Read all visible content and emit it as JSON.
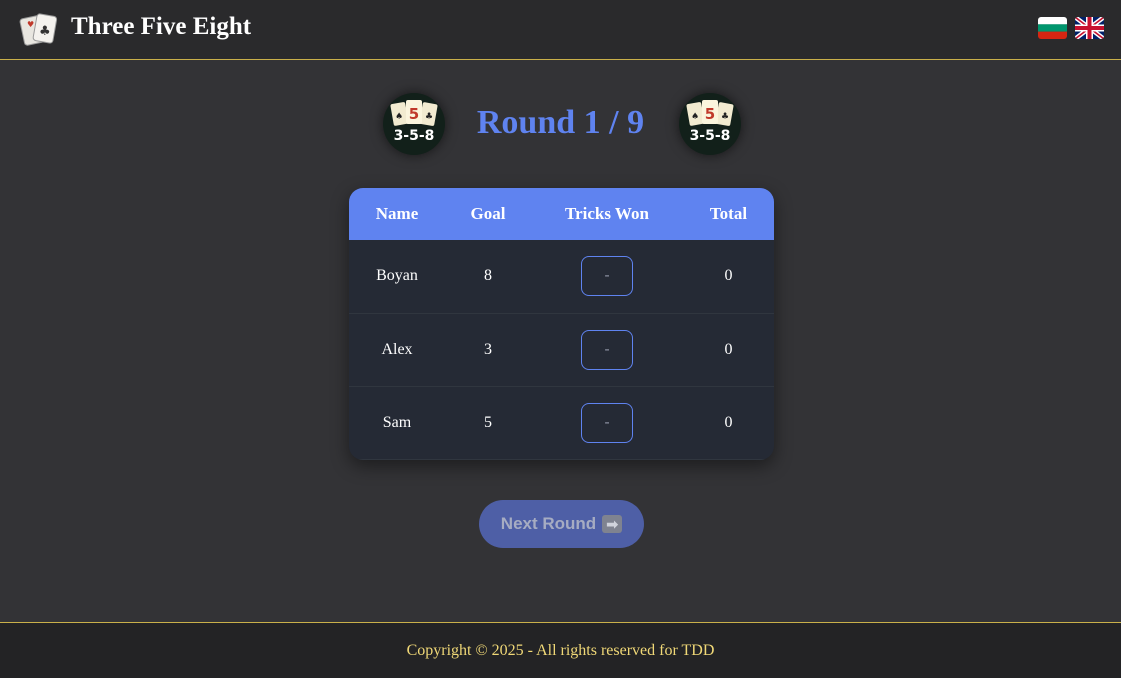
{
  "header": {
    "title": "Three Five Eight",
    "logo_icon": "playing-cards-icon",
    "languages": [
      {
        "code": "bg",
        "icon": "bulgarian-flag-icon"
      },
      {
        "code": "en",
        "icon": "uk-flag-icon"
      }
    ]
  },
  "round": {
    "title": "Round 1 / 9",
    "badge_label": "3-5-8",
    "badge_card": "5"
  },
  "table": {
    "columns": [
      "Name",
      "Goal",
      "Tricks Won",
      "Total"
    ],
    "rows": [
      {
        "name": "Boyan",
        "goal": "8",
        "tricks_placeholder": "-",
        "total": "0"
      },
      {
        "name": "Alex",
        "goal": "3",
        "tricks_placeholder": "-",
        "total": "0"
      },
      {
        "name": "Sam",
        "goal": "5",
        "tricks_placeholder": "-",
        "total": "0"
      }
    ]
  },
  "actions": {
    "next_round_label": "Next Round",
    "next_round_icon": "right-arrow-icon",
    "next_round_glyph": "➡"
  },
  "footer": {
    "copyright": "Copyright © 2025 - All rights reserved for TDD"
  },
  "colors": {
    "accent": "#5f83f0",
    "background": "#333336",
    "header": "#2a2a2c",
    "gold": "#c9b04a",
    "footer_text": "#f0d877"
  }
}
